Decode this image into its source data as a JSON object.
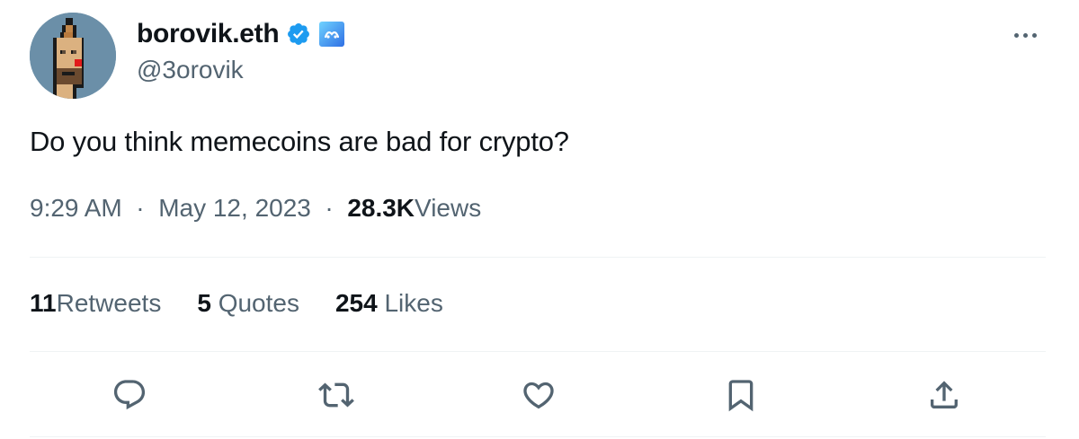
{
  "user": {
    "display_name": "borovik.eth",
    "handle": "@3orovik",
    "avatar_icon": "pixel-punk-avatar",
    "verified_icon": "verified-badge-icon",
    "affiliate_icon": "affiliate-badge-icon"
  },
  "tweet": {
    "text": "Do you think memecoins are bad for crypto?",
    "time": "9:29 AM",
    "sep1": "·",
    "date": "May 12, 2023",
    "sep2": "·",
    "views_count": "28.3K",
    "views_label": "Views"
  },
  "stats": {
    "retweets_count": "11",
    "retweets_label": "Retweets",
    "quotes_count": "5",
    "quotes_label": "Quotes",
    "likes_count": "254",
    "likes_label": "Likes"
  },
  "actions": {
    "reply_icon": "reply-icon",
    "retweet_icon": "retweet-icon",
    "like_icon": "heart-icon",
    "bookmark_icon": "bookmark-icon",
    "share_icon": "share-icon"
  },
  "colors": {
    "primary_text": "#0f1419",
    "secondary_text": "#536471",
    "verified_blue": "#1d9bf0",
    "divider": "#eff3f4"
  }
}
